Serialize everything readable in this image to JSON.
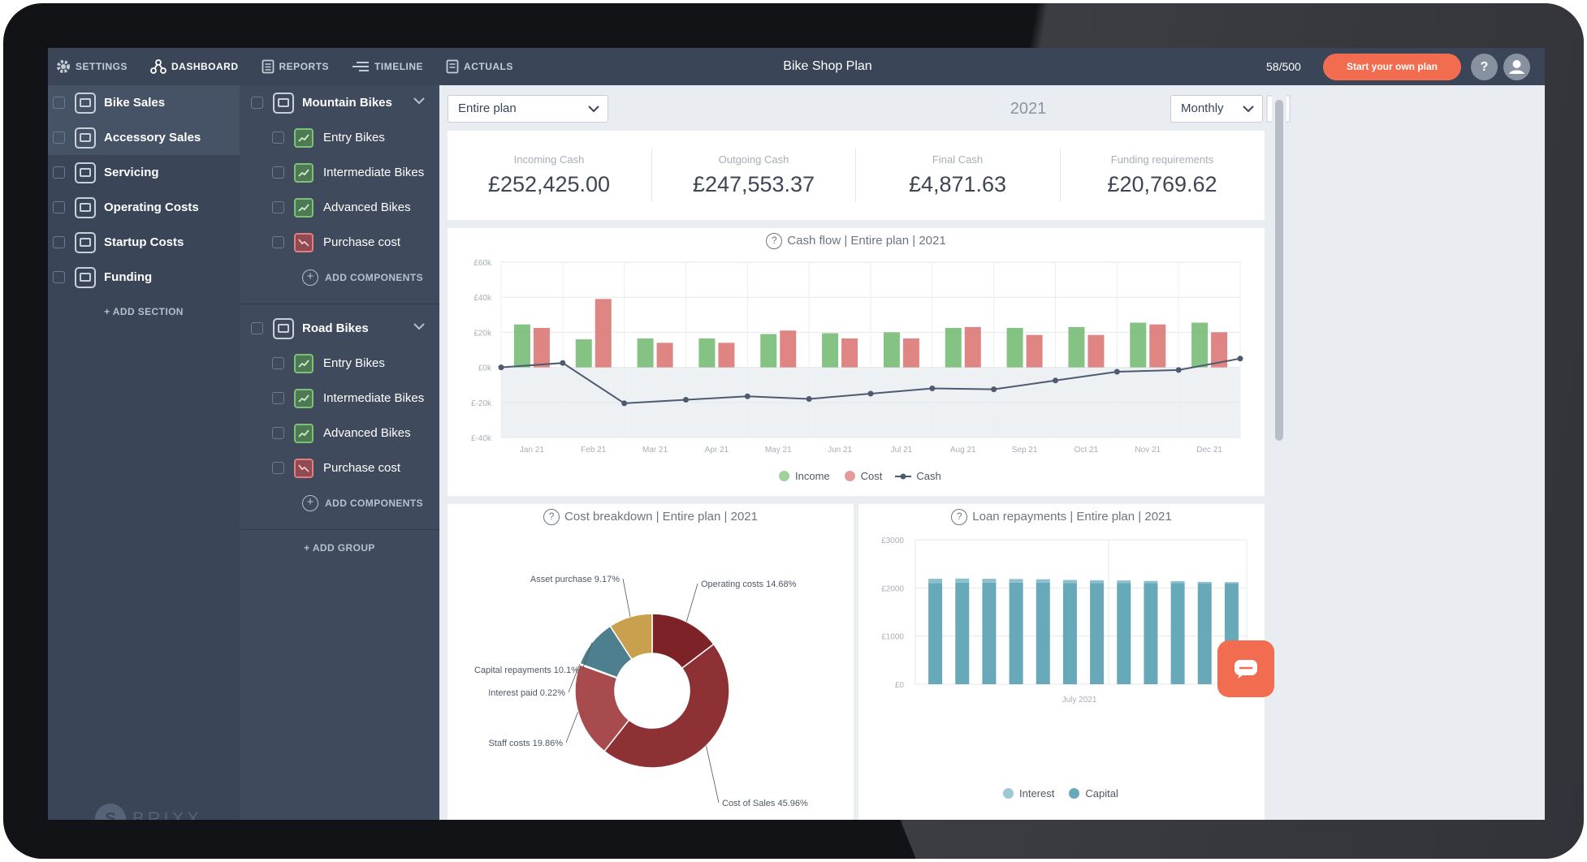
{
  "nav": {
    "items": [
      {
        "label": "SETTINGS",
        "icon": "gear-icon"
      },
      {
        "label": "DASHBOARD",
        "icon": "network-icon"
      },
      {
        "label": "REPORTS",
        "icon": "document-icon"
      },
      {
        "label": "TIMELINE",
        "icon": "timeline-icon"
      },
      {
        "label": "ACTUALS",
        "icon": "clipboard-icon"
      }
    ],
    "plan_title": "Bike Shop Plan",
    "counter": "58/500",
    "cta_label": "Start your own plan",
    "help_label": "?"
  },
  "sections": {
    "items": [
      "Bike Sales",
      "Accessory Sales",
      "Servicing",
      "Operating Costs",
      "Startup Costs",
      "Funding"
    ],
    "add_label": "+ ADD SECTION"
  },
  "groups": [
    {
      "name": "Mountain Bikes",
      "components": [
        {
          "label": "Entry Bikes",
          "kind": "income"
        },
        {
          "label": "Intermediate Bikes",
          "kind": "income"
        },
        {
          "label": "Advanced Bikes",
          "kind": "income"
        },
        {
          "label": "Purchase cost",
          "kind": "cost"
        }
      ],
      "add_label": "ADD COMPONENTS"
    },
    {
      "name": "Road Bikes",
      "components": [
        {
          "label": "Entry Bikes",
          "kind": "income"
        },
        {
          "label": "Intermediate Bikes",
          "kind": "income"
        },
        {
          "label": "Advanced Bikes",
          "kind": "income"
        },
        {
          "label": "Purchase cost",
          "kind": "cost"
        }
      ],
      "add_label": "ADD COMPONENTS"
    }
  ],
  "add_group_label": "+ ADD GROUP",
  "brand": "BRIXX",
  "filters": {
    "scope": "Entire plan",
    "year": "2021",
    "period": "Monthly"
  },
  "kpis": [
    {
      "label": "Incoming Cash",
      "value": "£252,425.00"
    },
    {
      "label": "Outgoing Cash",
      "value": "£247,553.37"
    },
    {
      "label": "Final Cash",
      "value": "£4,871.63"
    },
    {
      "label": "Funding requirements",
      "value": "£20,769.62"
    }
  ],
  "colors": {
    "income": "#6fb96e",
    "cost": "#d9706f",
    "cash": "#4d5a6f",
    "interest": "#8cc0cc",
    "capital": "#68a9b9",
    "accent": "#f26d4f"
  },
  "chart_data": [
    {
      "type": "bar",
      "title": "Cash flow | Entire plan | 2021",
      "categories": [
        "Jan 21",
        "Feb 21",
        "Mar 21",
        "Apr 21",
        "May 21",
        "Jun 21",
        "Jul 21",
        "Aug 21",
        "Sep 21",
        "Oct 21",
        "Nov 21",
        "Dec 21"
      ],
      "y_ticks": [
        "£60k",
        "£40k",
        "£20k",
        "£0k",
        "£-20k",
        "£-40k"
      ],
      "ylim": [
        -40000,
        60000
      ],
      "series": [
        {
          "name": "Income",
          "type": "bar",
          "values": [
            24500,
            16000,
            16500,
            16500,
            19000,
            19500,
            20000,
            22500,
            22500,
            23000,
            25500,
            25500
          ]
        },
        {
          "name": "Cost",
          "type": "bar",
          "values": [
            22500,
            39000,
            14000,
            14000,
            21000,
            16500,
            16500,
            23000,
            18500,
            18500,
            24500,
            20000
          ]
        },
        {
          "name": "Cash",
          "type": "line",
          "x": [
            "Jan 1",
            "Jan 21",
            "Feb 21",
            "Mar 21",
            "Apr 21",
            "May 21",
            "Jun 21",
            "Jul 21",
            "Aug 21",
            "Sep 21",
            "Oct 21",
            "Nov 21",
            "Dec 21"
          ],
          "values": [
            0,
            2500,
            -20500,
            -18500,
            -16500,
            -18000,
            -15000,
            -12000,
            -12500,
            -7500,
            -2500,
            -1500,
            5000
          ]
        }
      ],
      "legend": [
        "Income",
        "Cost",
        "Cash"
      ],
      "grid": true
    },
    {
      "type": "pie",
      "title": "Cost breakdown | Entire plan | 2021",
      "slices": [
        {
          "label": "Operating costs 14.68%",
          "value": 14.68,
          "color": "#7d2327"
        },
        {
          "label": "Cost of Sales 45.96%",
          "value": 45.96,
          "color": "#8e3135"
        },
        {
          "label": "Staff costs 19.86%",
          "value": 19.86,
          "color": "#a84b4f"
        },
        {
          "label": "Interest paid 0.22%",
          "value": 0.22,
          "color": "#3a6e84"
        },
        {
          "label": "Capital repayments 10.1%",
          "value": 10.1,
          "color": "#4e7f8f"
        },
        {
          "label": "Asset purchase 9.17%",
          "value": 9.17,
          "color": "#c9a04e"
        }
      ]
    },
    {
      "type": "bar",
      "title": "Loan repayments | Entire plan | 2021",
      "y_ticks": [
        "£3000",
        "£2000",
        "£1000",
        "£0"
      ],
      "ylim": [
        0,
        3000
      ],
      "x_label": "July 2021",
      "series": [
        {
          "name": "Interest",
          "values": [
            90,
            85,
            80,
            75,
            70,
            65,
            60,
            55,
            45,
            40,
            35,
            30
          ]
        },
        {
          "name": "Capital",
          "values": [
            2100,
            2110,
            2110,
            2110,
            2110,
            2100,
            2100,
            2100,
            2100,
            2100,
            2090,
            2090
          ]
        }
      ],
      "legend": [
        "Interest",
        "Capital"
      ]
    }
  ]
}
